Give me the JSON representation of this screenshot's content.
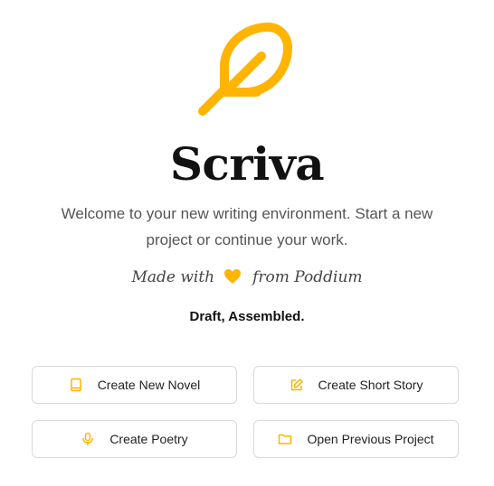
{
  "app": {
    "title": "Scriva",
    "logo_icon": "feather-icon",
    "welcome": "Welcome to your new writing environment. Start a new project or continue your work.",
    "made_with_prefix": "Made with",
    "made_with_icon": "heart-icon",
    "made_with_suffix": "from Poddium",
    "tagline": "Draft, Assembled."
  },
  "colors": {
    "accent": "#FFB400",
    "border": "#D9D9D9",
    "text_muted": "#555555"
  },
  "actions": [
    {
      "label": "Create New Novel",
      "icon": "book-icon"
    },
    {
      "label": "Create Short Story",
      "icon": "edit-icon"
    },
    {
      "label": "Create Poetry",
      "icon": "microphone-icon"
    },
    {
      "label": "Open Previous Project",
      "icon": "folder-icon"
    }
  ]
}
